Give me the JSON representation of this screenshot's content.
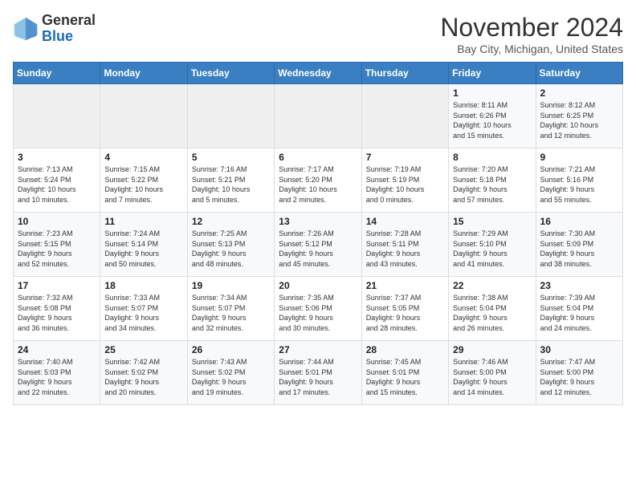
{
  "header": {
    "logo_line1": "General",
    "logo_line2": "Blue",
    "month": "November 2024",
    "location": "Bay City, Michigan, United States"
  },
  "weekdays": [
    "Sunday",
    "Monday",
    "Tuesday",
    "Wednesday",
    "Thursday",
    "Friday",
    "Saturday"
  ],
  "weeks": [
    [
      {
        "day": "",
        "info": ""
      },
      {
        "day": "",
        "info": ""
      },
      {
        "day": "",
        "info": ""
      },
      {
        "day": "",
        "info": ""
      },
      {
        "day": "",
        "info": ""
      },
      {
        "day": "1",
        "info": "Sunrise: 8:11 AM\nSunset: 6:26 PM\nDaylight: 10 hours\nand 15 minutes."
      },
      {
        "day": "2",
        "info": "Sunrise: 8:12 AM\nSunset: 6:25 PM\nDaylight: 10 hours\nand 12 minutes."
      }
    ],
    [
      {
        "day": "3",
        "info": "Sunrise: 7:13 AM\nSunset: 5:24 PM\nDaylight: 10 hours\nand 10 minutes."
      },
      {
        "day": "4",
        "info": "Sunrise: 7:15 AM\nSunset: 5:22 PM\nDaylight: 10 hours\nand 7 minutes."
      },
      {
        "day": "5",
        "info": "Sunrise: 7:16 AM\nSunset: 5:21 PM\nDaylight: 10 hours\nand 5 minutes."
      },
      {
        "day": "6",
        "info": "Sunrise: 7:17 AM\nSunset: 5:20 PM\nDaylight: 10 hours\nand 2 minutes."
      },
      {
        "day": "7",
        "info": "Sunrise: 7:19 AM\nSunset: 5:19 PM\nDaylight: 10 hours\nand 0 minutes."
      },
      {
        "day": "8",
        "info": "Sunrise: 7:20 AM\nSunset: 5:18 PM\nDaylight: 9 hours\nand 57 minutes."
      },
      {
        "day": "9",
        "info": "Sunrise: 7:21 AM\nSunset: 5:16 PM\nDaylight: 9 hours\nand 55 minutes."
      }
    ],
    [
      {
        "day": "10",
        "info": "Sunrise: 7:23 AM\nSunset: 5:15 PM\nDaylight: 9 hours\nand 52 minutes."
      },
      {
        "day": "11",
        "info": "Sunrise: 7:24 AM\nSunset: 5:14 PM\nDaylight: 9 hours\nand 50 minutes."
      },
      {
        "day": "12",
        "info": "Sunrise: 7:25 AM\nSunset: 5:13 PM\nDaylight: 9 hours\nand 48 minutes."
      },
      {
        "day": "13",
        "info": "Sunrise: 7:26 AM\nSunset: 5:12 PM\nDaylight: 9 hours\nand 45 minutes."
      },
      {
        "day": "14",
        "info": "Sunrise: 7:28 AM\nSunset: 5:11 PM\nDaylight: 9 hours\nand 43 minutes."
      },
      {
        "day": "15",
        "info": "Sunrise: 7:29 AM\nSunset: 5:10 PM\nDaylight: 9 hours\nand 41 minutes."
      },
      {
        "day": "16",
        "info": "Sunrise: 7:30 AM\nSunset: 5:09 PM\nDaylight: 9 hours\nand 38 minutes."
      }
    ],
    [
      {
        "day": "17",
        "info": "Sunrise: 7:32 AM\nSunset: 5:08 PM\nDaylight: 9 hours\nand 36 minutes."
      },
      {
        "day": "18",
        "info": "Sunrise: 7:33 AM\nSunset: 5:07 PM\nDaylight: 9 hours\nand 34 minutes."
      },
      {
        "day": "19",
        "info": "Sunrise: 7:34 AM\nSunset: 5:07 PM\nDaylight: 9 hours\nand 32 minutes."
      },
      {
        "day": "20",
        "info": "Sunrise: 7:35 AM\nSunset: 5:06 PM\nDaylight: 9 hours\nand 30 minutes."
      },
      {
        "day": "21",
        "info": "Sunrise: 7:37 AM\nSunset: 5:05 PM\nDaylight: 9 hours\nand 28 minutes."
      },
      {
        "day": "22",
        "info": "Sunrise: 7:38 AM\nSunset: 5:04 PM\nDaylight: 9 hours\nand 26 minutes."
      },
      {
        "day": "23",
        "info": "Sunrise: 7:39 AM\nSunset: 5:04 PM\nDaylight: 9 hours\nand 24 minutes."
      }
    ],
    [
      {
        "day": "24",
        "info": "Sunrise: 7:40 AM\nSunset: 5:03 PM\nDaylight: 9 hours\nand 22 minutes."
      },
      {
        "day": "25",
        "info": "Sunrise: 7:42 AM\nSunset: 5:02 PM\nDaylight: 9 hours\nand 20 minutes."
      },
      {
        "day": "26",
        "info": "Sunrise: 7:43 AM\nSunset: 5:02 PM\nDaylight: 9 hours\nand 19 minutes."
      },
      {
        "day": "27",
        "info": "Sunrise: 7:44 AM\nSunset: 5:01 PM\nDaylight: 9 hours\nand 17 minutes."
      },
      {
        "day": "28",
        "info": "Sunrise: 7:45 AM\nSunset: 5:01 PM\nDaylight: 9 hours\nand 15 minutes."
      },
      {
        "day": "29",
        "info": "Sunrise: 7:46 AM\nSunset: 5:00 PM\nDaylight: 9 hours\nand 14 minutes."
      },
      {
        "day": "30",
        "info": "Sunrise: 7:47 AM\nSunset: 5:00 PM\nDaylight: 9 hours\nand 12 minutes."
      }
    ]
  ]
}
